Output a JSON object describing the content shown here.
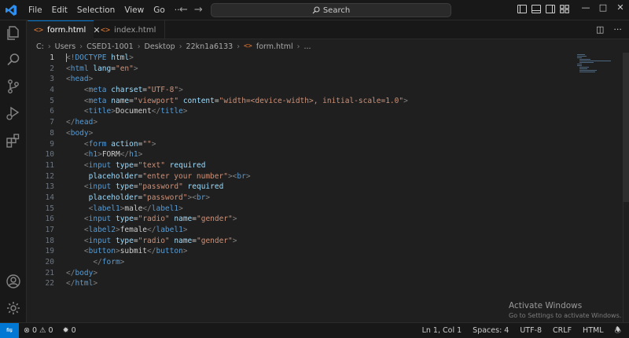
{
  "menu": [
    "File",
    "Edit",
    "Selection",
    "View",
    "Go",
    "···"
  ],
  "search": {
    "label": "Search"
  },
  "tabs": [
    {
      "label": "form.html",
      "icon": "<>",
      "active": true
    },
    {
      "label": "index.html",
      "icon": "<>",
      "active": false
    }
  ],
  "breadcrumb": [
    "C:",
    "Users",
    "CSED1-1001",
    "Desktop",
    "22kn1a6133",
    "form.html",
    "..."
  ],
  "editor": {
    "current_line": 1,
    "lines": [
      [
        [
          "<!",
          "br"
        ],
        [
          "DOCTYPE",
          "tag"
        ],
        [
          " ",
          "txt"
        ],
        [
          "html",
          "attr"
        ],
        [
          ">",
          "br"
        ]
      ],
      [
        [
          "<",
          "br"
        ],
        [
          "html",
          "tag"
        ],
        [
          " ",
          "txt"
        ],
        [
          "lang",
          "attr"
        ],
        [
          "=",
          "txt"
        ],
        [
          "\"en\"",
          "str"
        ],
        [
          ">",
          "br"
        ]
      ],
      [
        [
          "<",
          "br"
        ],
        [
          "head",
          "tag"
        ],
        [
          ">",
          "br"
        ]
      ],
      [
        [
          "    ",
          "txt"
        ],
        [
          "<",
          "br"
        ],
        [
          "meta",
          "tag"
        ],
        [
          " ",
          "txt"
        ],
        [
          "charset",
          "attr"
        ],
        [
          "=",
          "txt"
        ],
        [
          "\"UTF-8\"",
          "str"
        ],
        [
          ">",
          "br"
        ]
      ],
      [
        [
          "    ",
          "txt"
        ],
        [
          "<",
          "br"
        ],
        [
          "meta",
          "tag"
        ],
        [
          " ",
          "txt"
        ],
        [
          "name",
          "attr"
        ],
        [
          "=",
          "txt"
        ],
        [
          "\"viewport\"",
          "str"
        ],
        [
          " ",
          "txt"
        ],
        [
          "content",
          "attr"
        ],
        [
          "=",
          "txt"
        ],
        [
          "\"width=<device-width>, initial-scale=1.0\"",
          "str"
        ],
        [
          ">",
          "br"
        ]
      ],
      [
        [
          "    ",
          "txt"
        ],
        [
          "<",
          "br"
        ],
        [
          "title",
          "tag"
        ],
        [
          ">",
          "br"
        ],
        [
          "Document",
          "txt"
        ],
        [
          "</",
          "br"
        ],
        [
          "title",
          "tag"
        ],
        [
          ">",
          "br"
        ]
      ],
      [
        [
          "</",
          "br"
        ],
        [
          "head",
          "tag"
        ],
        [
          ">",
          "br"
        ]
      ],
      [
        [
          "<",
          "br"
        ],
        [
          "body",
          "tag"
        ],
        [
          ">",
          "br"
        ]
      ],
      [
        [
          "    ",
          "txt"
        ],
        [
          "<",
          "br"
        ],
        [
          "form",
          "tag"
        ],
        [
          " ",
          "txt"
        ],
        [
          "action",
          "attr"
        ],
        [
          "=",
          "txt"
        ],
        [
          "\"\"",
          "str"
        ],
        [
          ">",
          "br"
        ]
      ],
      [
        [
          "    ",
          "txt"
        ],
        [
          "<",
          "br"
        ],
        [
          "h1",
          "tag"
        ],
        [
          ">",
          "br"
        ],
        [
          "FORM",
          "txt"
        ],
        [
          "</",
          "br"
        ],
        [
          "h1",
          "tag"
        ],
        [
          ">",
          "br"
        ]
      ],
      [
        [
          "    ",
          "txt"
        ],
        [
          "<",
          "br"
        ],
        [
          "input",
          "tag"
        ],
        [
          " ",
          "txt"
        ],
        [
          "type",
          "attr"
        ],
        [
          "=",
          "txt"
        ],
        [
          "\"text\"",
          "str"
        ],
        [
          " ",
          "txt"
        ],
        [
          "required",
          "attr"
        ]
      ],
      [
        [
          "     ",
          "txt"
        ],
        [
          "placeholder",
          "attr"
        ],
        [
          "=",
          "txt"
        ],
        [
          "\"enter your number\"",
          "str"
        ],
        [
          ">",
          "br"
        ],
        [
          "<",
          "br"
        ],
        [
          "br",
          "tag"
        ],
        [
          ">",
          "br"
        ]
      ],
      [
        [
          "    ",
          "txt"
        ],
        [
          "<",
          "br"
        ],
        [
          "input",
          "tag"
        ],
        [
          " ",
          "txt"
        ],
        [
          "type",
          "attr"
        ],
        [
          "=",
          "txt"
        ],
        [
          "\"password\"",
          "str"
        ],
        [
          " ",
          "txt"
        ],
        [
          "required",
          "attr"
        ]
      ],
      [
        [
          "     ",
          "txt"
        ],
        [
          "placeholder",
          "attr"
        ],
        [
          "=",
          "txt"
        ],
        [
          "\"password\"",
          "str"
        ],
        [
          ">",
          "br"
        ],
        [
          "<",
          "br"
        ],
        [
          "br",
          "tag"
        ],
        [
          ">",
          "br"
        ]
      ],
      [
        [
          "     ",
          "txt"
        ],
        [
          "<",
          "br"
        ],
        [
          "label1",
          "tag"
        ],
        [
          ">",
          "br"
        ],
        [
          "male",
          "txt"
        ],
        [
          "</",
          "br"
        ],
        [
          "label1",
          "tag"
        ],
        [
          ">",
          "br"
        ]
      ],
      [
        [
          "    ",
          "txt"
        ],
        [
          "<",
          "br"
        ],
        [
          "input",
          "tag"
        ],
        [
          " ",
          "txt"
        ],
        [
          "type",
          "attr"
        ],
        [
          "=",
          "txt"
        ],
        [
          "\"radio\"",
          "str"
        ],
        [
          " ",
          "txt"
        ],
        [
          "name",
          "attr"
        ],
        [
          "=",
          "txt"
        ],
        [
          "\"gender\"",
          "str"
        ],
        [
          ">",
          "br"
        ]
      ],
      [
        [
          "    ",
          "txt"
        ],
        [
          "<",
          "br"
        ],
        [
          "label2",
          "tag"
        ],
        [
          ">",
          "br"
        ],
        [
          "female",
          "txt"
        ],
        [
          "</",
          "br"
        ],
        [
          "label1",
          "tag"
        ],
        [
          ">",
          "br"
        ]
      ],
      [
        [
          "    ",
          "txt"
        ],
        [
          "<",
          "br"
        ],
        [
          "input",
          "tag"
        ],
        [
          " ",
          "txt"
        ],
        [
          "type",
          "attr"
        ],
        [
          "=",
          "txt"
        ],
        [
          "\"radio\"",
          "str"
        ],
        [
          " ",
          "txt"
        ],
        [
          "name",
          "attr"
        ],
        [
          "=",
          "txt"
        ],
        [
          "\"gender\"",
          "str"
        ],
        [
          ">",
          "br"
        ]
      ],
      [
        [
          "    ",
          "txt"
        ],
        [
          "<",
          "br"
        ],
        [
          "button",
          "tag"
        ],
        [
          ">",
          "br"
        ],
        [
          "submit",
          "txt"
        ],
        [
          "</",
          "br"
        ],
        [
          "button",
          "tag"
        ],
        [
          ">",
          "br"
        ]
      ],
      [
        [
          "      ",
          "txt"
        ],
        [
          "</",
          "br"
        ],
        [
          "form",
          "tag"
        ],
        [
          ">",
          "br"
        ]
      ],
      [
        [
          "</",
          "br"
        ],
        [
          "body",
          "tag"
        ],
        [
          ">",
          "br"
        ]
      ],
      [
        [
          "</",
          "br"
        ],
        [
          "html",
          "tag"
        ],
        [
          ">",
          "br"
        ]
      ]
    ]
  },
  "watermark": {
    "title": "Activate Windows",
    "subtitle": "Go to Settings to activate Windows."
  },
  "status": {
    "errors": "0",
    "warnings": "0",
    "ports": "0",
    "position": "Ln 1, Col 1",
    "spaces": "Spaces: 4",
    "encoding": "UTF-8",
    "eol": "CRLF",
    "language": "HTML"
  },
  "colors": {
    "accent": "#0078d4",
    "tag": "#569cd6",
    "attribute": "#9cdcfe",
    "string": "#ce9178",
    "text": "#cccccc",
    "bracket": "#808080"
  }
}
